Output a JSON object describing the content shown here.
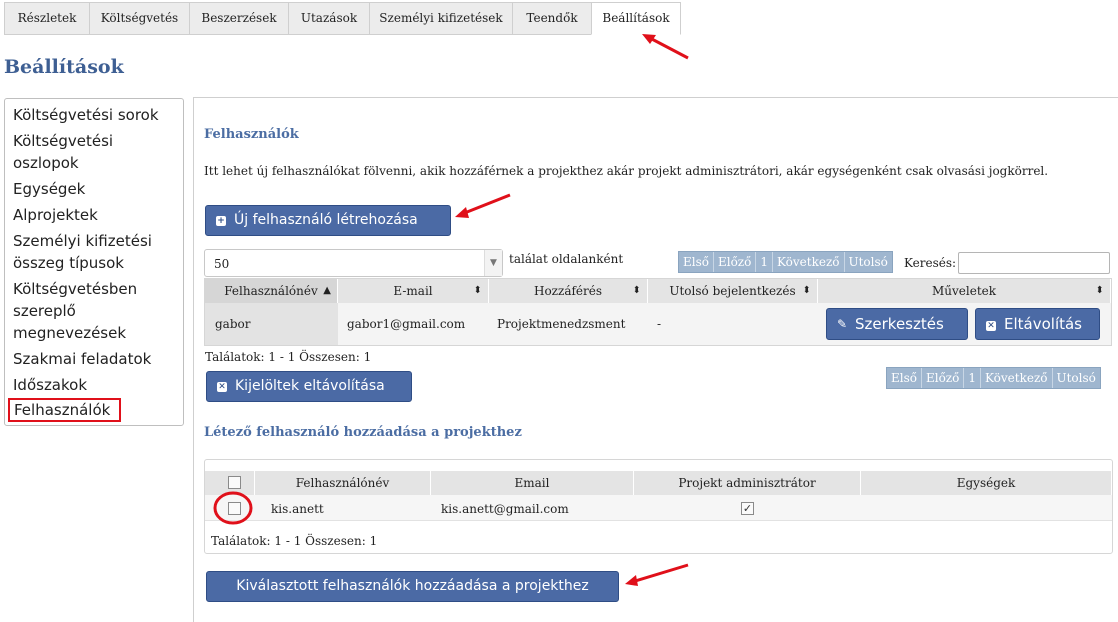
{
  "tabs": [
    {
      "label": "Részletek"
    },
    {
      "label": "Költségvetés"
    },
    {
      "label": "Beszerzések"
    },
    {
      "label": "Utazások"
    },
    {
      "label": "Személyi kifizetések"
    },
    {
      "label": "Teendők"
    },
    {
      "label": "Beállítások",
      "active": true
    }
  ],
  "page_title": "Beállítások",
  "sidebar": {
    "items": [
      {
        "label": "Költségvetési sorok"
      },
      {
        "label": "Költségvetési"
      },
      {
        "label": "oszlopok"
      },
      {
        "label": "Egységek"
      },
      {
        "label": "Alprojektek"
      },
      {
        "label": "Személyi kifizetési"
      },
      {
        "label": "összeg típusok"
      },
      {
        "label": "Költségvetésben"
      },
      {
        "label": "szereplő"
      },
      {
        "label": "megnevezések"
      },
      {
        "label": "Szakmai feladatok"
      },
      {
        "label": "Időszakok"
      },
      {
        "label": "Felhasználók",
        "selected": true
      }
    ]
  },
  "users": {
    "heading": "Felhasználók",
    "description": "Itt lehet új felhasználókat fölvenni, akik hozzáférnek a projekthez akár projekt adminisztrátori, akár egységenként csak olvasási jogkörrel.",
    "new_user_button": "Új felhasználó létrehozása",
    "page_size": "50",
    "page_size_suffix": "találat oldalanként",
    "pager": {
      "first": "Első",
      "prev": "Előző",
      "page": "1",
      "next": "Következő",
      "last": "Utolsó"
    },
    "search_label": "Keresés:",
    "search_value": "",
    "columns": [
      "Felhasználónév",
      "E-mail",
      "Hozzáférés",
      "Utolsó bejelentkezés",
      "Műveletek"
    ],
    "rows": [
      {
        "username": "gabor",
        "email": "gabor1@gmail.com",
        "access": "Projektmenedzsment",
        "last_login": "-"
      }
    ],
    "edit_button": "Szerkesztés",
    "remove_button": "Eltávolítás",
    "results_info": "Találatok: 1 - 1 Összesen: 1",
    "remove_selected_button": "Kijelöltek eltávolítása"
  },
  "existing": {
    "heading": "Létező felhasználó hozzáadása a projekthez",
    "columns": [
      "Felhasználónév",
      "Email",
      "Projekt adminisztrátor",
      "Egységek"
    ],
    "rows": [
      {
        "username": "kis.anett",
        "email": "kis.anett@gmail.com",
        "admin_checked": true
      }
    ],
    "results_info": "Találatok: 1 - 1 Összesen: 1",
    "add_button": "Kiválasztott felhasználók hozzáadása a projekthez"
  },
  "colors": {
    "accent": "#4b6aa5",
    "title": "#3e5f93",
    "highlight": "#e0101a"
  },
  "icons": {
    "sort": "sort-arrows-icon",
    "edit": "pencil-icon",
    "remove": "x-icon",
    "add": "plus-icon"
  }
}
